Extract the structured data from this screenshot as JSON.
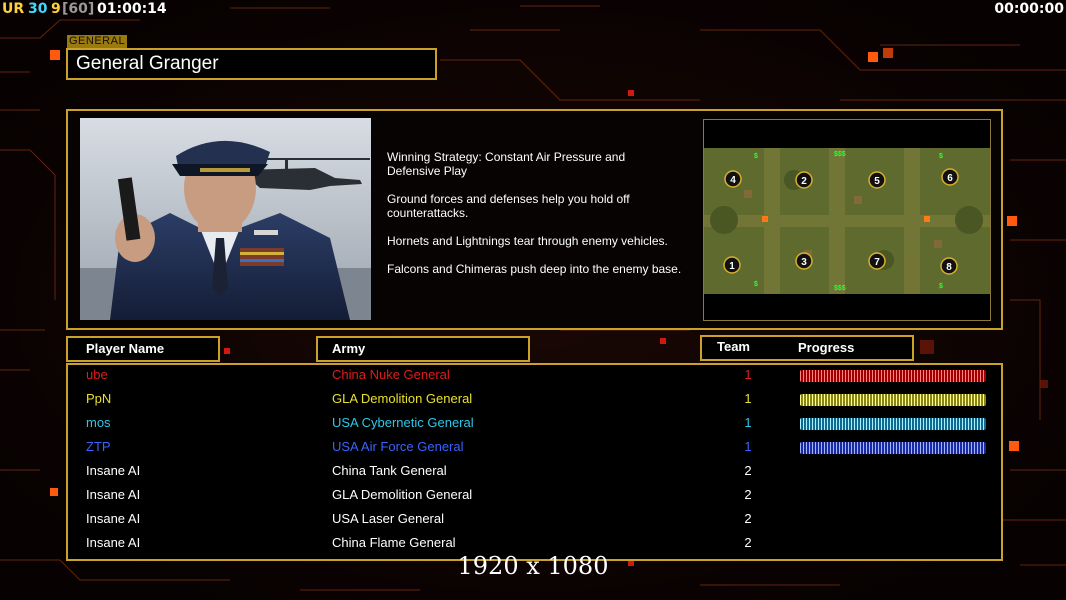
{
  "hud": {
    "ur_label": "UR",
    "fps": "30",
    "frame_n": "9",
    "frame_max": "[60]",
    "game_time": "01:00:14",
    "countdown": "00:00:00"
  },
  "general": {
    "tag": "GENERAL",
    "name": "General Granger"
  },
  "strategy": [
    "Winning Strategy: Constant Air Pressure and\n Defensive Play",
    "Ground forces and defenses help you hold off\n counterattacks.",
    "Hornets and Lightnings tear through enemy vehicles.",
    "Falcons and Chimeras push deep into the enemy base."
  ],
  "minimap": {
    "slots": [
      "4",
      "2",
      "5",
      "6",
      "1",
      "3",
      "7",
      "8"
    ]
  },
  "headers": {
    "player": "Player Name",
    "army": "Army",
    "team": "Team",
    "progress": "Progress"
  },
  "players": [
    {
      "name": "ube",
      "army": "China Nuke General",
      "team": "1",
      "color": "#e01c1c",
      "progress": 1.0
    },
    {
      "name": "PpN",
      "army": "GLA Demolition General",
      "team": "1",
      "color": "#e8e030",
      "progress": 1.0
    },
    {
      "name": "mos",
      "army": "USA Cybernetic General",
      "team": "1",
      "color": "#2cc8e8",
      "progress": 1.0
    },
    {
      "name": "ZTP",
      "army": "USA Air Force General",
      "team": "1",
      "color": "#3a62ff",
      "progress": 1.0
    },
    {
      "name": "Insane AI",
      "army": "China Tank General",
      "team": "2",
      "color": "#ffffff",
      "progress": null
    },
    {
      "name": "Insane AI",
      "army": "GLA Demolition General",
      "team": "2",
      "color": "#ffffff",
      "progress": null
    },
    {
      "name": "Insane AI",
      "army": "USA Laser General",
      "team": "2",
      "color": "#ffffff",
      "progress": null
    },
    {
      "name": "Insane AI",
      "army": "China Flame General",
      "team": "2",
      "color": "#ffffff",
      "progress": null
    }
  ],
  "resolution_caption": "1920 x 1080",
  "colors": {
    "frame_gold": "#c9a227",
    "bg": "#0c0303",
    "accent_orange": "#ff5a10"
  }
}
